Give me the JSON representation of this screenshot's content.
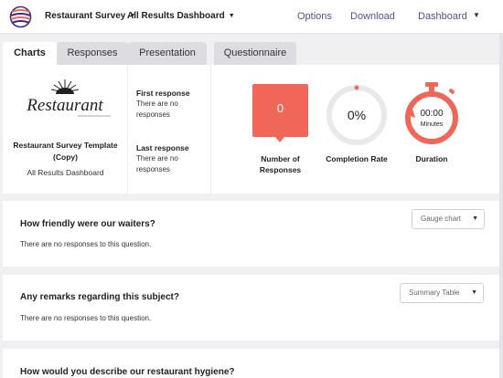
{
  "header": {
    "survey_name": "Restaurant Survey",
    "dashboard_name": "All Results Dashboard",
    "nav": {
      "options": "Options",
      "download": "Download",
      "dashboard": "Dashboard"
    }
  },
  "tabs": [
    {
      "label": "Charts",
      "active": true
    },
    {
      "label": "Responses",
      "active": false
    },
    {
      "label": "Presentation",
      "active": false
    },
    {
      "label": "Questionnaire",
      "active": false
    }
  ],
  "summary": {
    "logo_text": "Restaurant",
    "survey_title": "Restaurant Survey Template (Copy)",
    "dashboard_label": "All Results Dashboard",
    "first_response": {
      "label": "First response",
      "text": "There are no responses"
    },
    "last_response": {
      "label": "Last response",
      "text": "There are no responses"
    },
    "stats": {
      "responses": {
        "value": "0",
        "label": "Number of Responses"
      },
      "completion": {
        "value": "0%",
        "label": "Completion Rate"
      },
      "duration": {
        "value": "00:00",
        "unit": "Minutes",
        "label": "Duration"
      }
    }
  },
  "questions": [
    {
      "title": "How friendly were our waiters?",
      "empty_text": "There are no responses to this question.",
      "chart_type": "Gauge chart"
    },
    {
      "title": "Any remarks regarding this subject?",
      "empty_text": "There are no responses to this question.",
      "chart_type": "Summary Table"
    },
    {
      "title": "How would you describe our restaurant hygiene?"
    }
  ],
  "colors": {
    "accent": "#f0675a",
    "nav_link": "#5c4b8a",
    "tab_inactive": "#dcdce1",
    "background": "#f0f0f3"
  }
}
